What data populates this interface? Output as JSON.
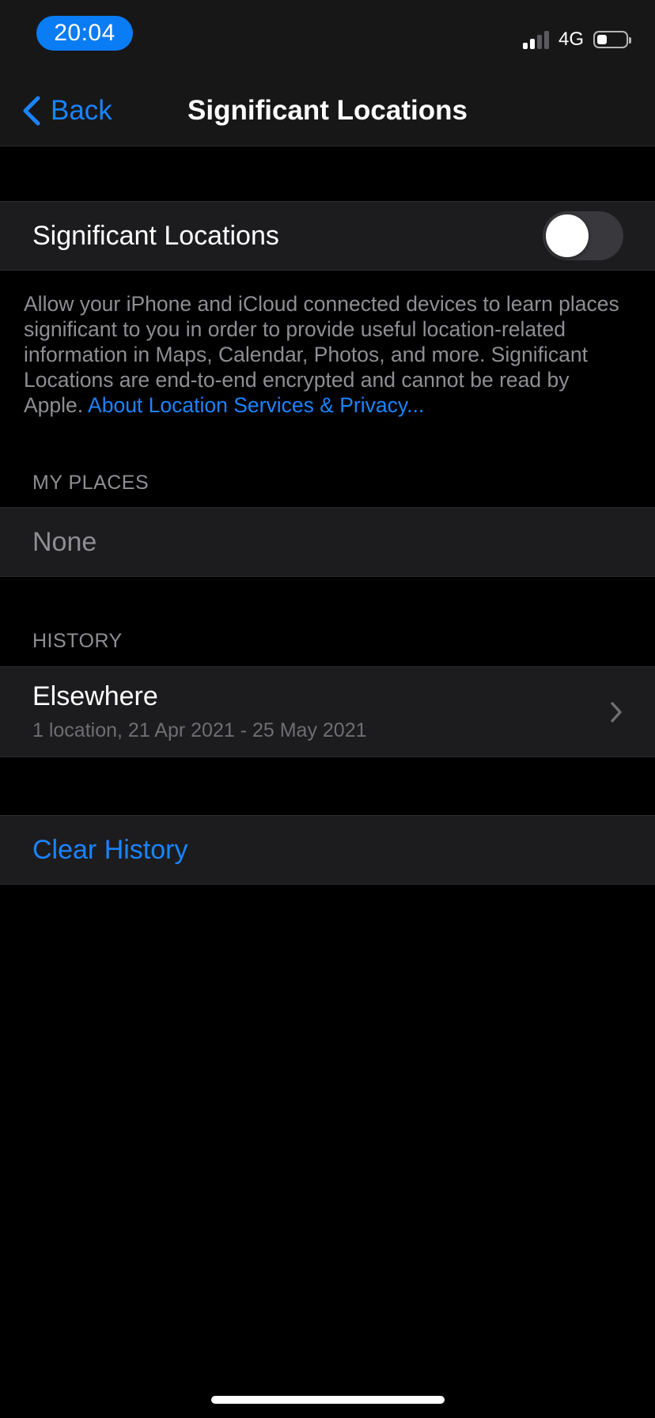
{
  "status_bar": {
    "time": "20:04",
    "network": "4G",
    "signal_bars_active": 2,
    "battery_level": 0.35
  },
  "nav": {
    "back_label": "Back",
    "title": "Significant Locations"
  },
  "toggle_cell": {
    "label": "Significant Locations",
    "enabled": false
  },
  "footer": {
    "text": "Allow your iPhone and iCloud connected devices to learn places significant to you in order to provide useful location-related information in Maps, Calendar, Photos, and more. Significant Locations are end-to-end encrypted and cannot be read by Apple. ",
    "link": "About Location Services & Privacy..."
  },
  "my_places": {
    "header": "MY PLACES",
    "empty_label": "None"
  },
  "history": {
    "header": "HISTORY",
    "items": [
      {
        "title": "Elsewhere",
        "subtitle": "1 location, 21 Apr 2021 - 25 May 2021"
      }
    ]
  },
  "actions": {
    "clear_history": "Clear History"
  },
  "colors": {
    "accent": "#1a84ff",
    "time_pill": "#0a7cf4",
    "background": "#000000",
    "cell": "#1c1c1e",
    "secondary_text": "#8e8e93"
  },
  "icons": {
    "back": "chevron-left-icon",
    "disclosure": "chevron-right-icon",
    "signal": "cellular-signal-icon",
    "battery": "battery-icon"
  }
}
